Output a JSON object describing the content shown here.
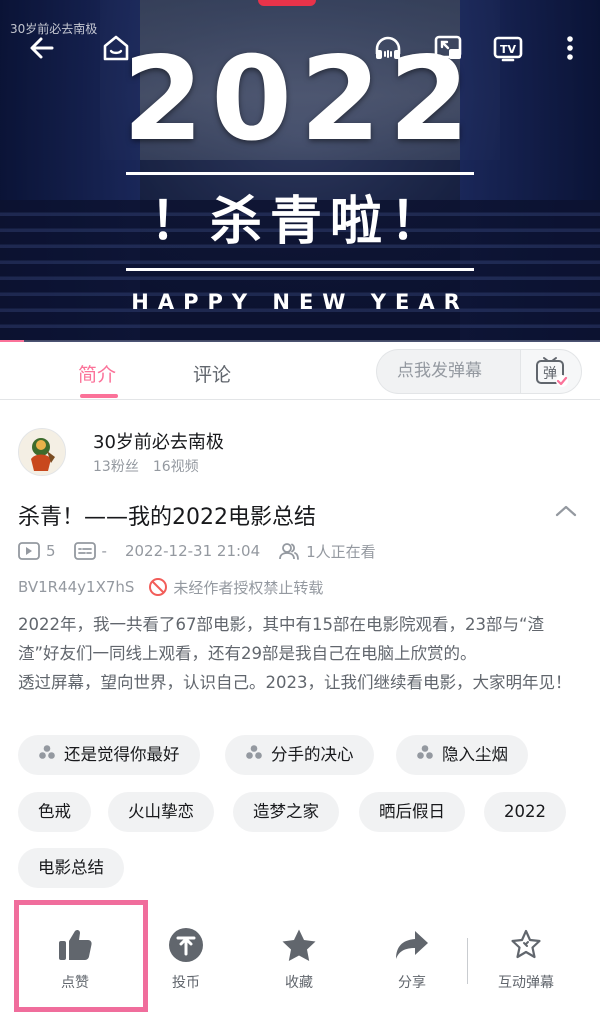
{
  "player": {
    "watermark": "30岁前必去南极",
    "poster_year": "2022",
    "poster_title": "！杀青啦！",
    "poster_subtitle": "HAPPY NEW YEAR",
    "progress_fraction": 0.04,
    "icons": [
      "back-arrow-icon",
      "home-icon",
      "headphones-icon",
      "pip-icon",
      "tv-cast-icon",
      "more-vertical-icon"
    ]
  },
  "tabs": {
    "items": [
      "简介",
      "评论"
    ],
    "active": "简介",
    "danmaku_placeholder": "点我发弹幕",
    "danmaku_toggle": "弹"
  },
  "uploader": {
    "name": "30岁前必去南极",
    "fans": "13粉丝",
    "videos": "16视频"
  },
  "video": {
    "title": "杀青！——我的2022电影总结",
    "views": "5",
    "danmaku_count": "-",
    "published": "2022-12-31 21:04",
    "watching": "1人正在看",
    "bvid": "BV1R44y1X7hS",
    "copyright_notice": "未经作者授权禁止转载",
    "description": "2022年，我一共看了67部电影，其中有15部在电影院观看，23部与“渣渣”好友们一同线上观看，还有29部是我自己在电脑上欣赏的。\n透过屏幕，望向世界，认识自己。2023，让我们继续看电影，大家明年见！"
  },
  "tags": {
    "bgm": [
      "还是觉得你最好",
      "分手的决心",
      "隐入尘烟"
    ],
    "plain": [
      "色戒",
      "火山挚恋",
      "造梦之家",
      "晒后假日",
      "2022",
      "电影总结"
    ]
  },
  "actions": {
    "like": "点赞",
    "coin": "投币",
    "favorite": "收藏",
    "share": "分享",
    "interactive_danmaku": "互动弹幕"
  },
  "colors": {
    "accent": "#fb7299",
    "highlight_box": "#f06d9c",
    "icon_gray": "#61666d"
  }
}
